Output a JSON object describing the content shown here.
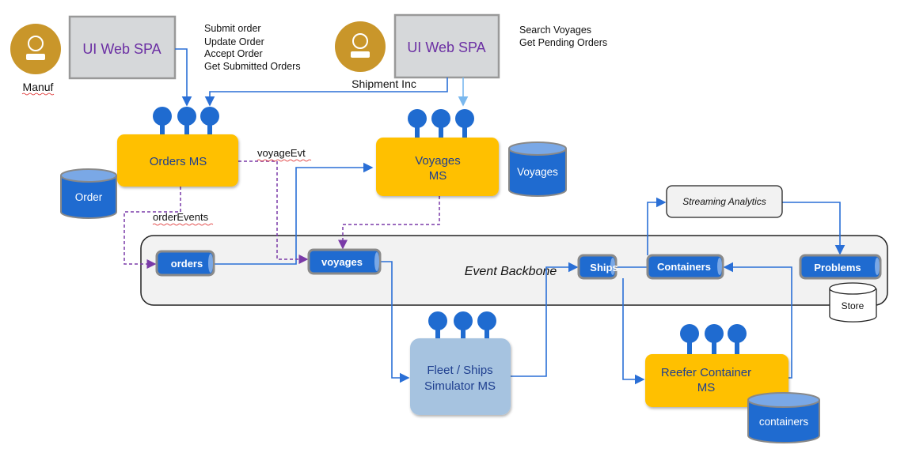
{
  "actors": [
    {
      "name": "Manuf"
    },
    {
      "name": "Shipment Inc"
    }
  ],
  "ui_boxes": [
    {
      "label": "UI Web SPA"
    },
    {
      "label": "UI Web SPA"
    }
  ],
  "manuf_operations": [
    "Submit order",
    "Update Order",
    "Accept Order",
    "Get Submitted Orders"
  ],
  "shipment_operations": [
    "Search Voyages",
    "Get Pending Orders"
  ],
  "services": {
    "orders": "Orders MS",
    "voyages": [
      "Voyages",
      "MS"
    ],
    "simulator": [
      "Fleet / Ships",
      "Simulator MS"
    ],
    "reefer": [
      "Reefer Container",
      "MS"
    ],
    "streaming": "Streaming Analytics"
  },
  "databases": {
    "order": "Order",
    "voyages": "Voyages",
    "containers": "containers",
    "store": "Store"
  },
  "backbone": {
    "label": "Event Backbone",
    "topics": [
      "orders",
      "voyages",
      "Ships",
      "Containers",
      "Problems"
    ]
  },
  "event_labels": {
    "voyage_evt": "voyageEvt",
    "order_events": "orderEvents"
  },
  "colors": {
    "service": "#ffc000",
    "simulator": "#a6c3e0",
    "topic": "#1f6bd0",
    "actor": "#c9962a",
    "ui_box": "#d6d8da",
    "flow": "#2a6fd6",
    "event_flow": "#7a3aa8"
  }
}
